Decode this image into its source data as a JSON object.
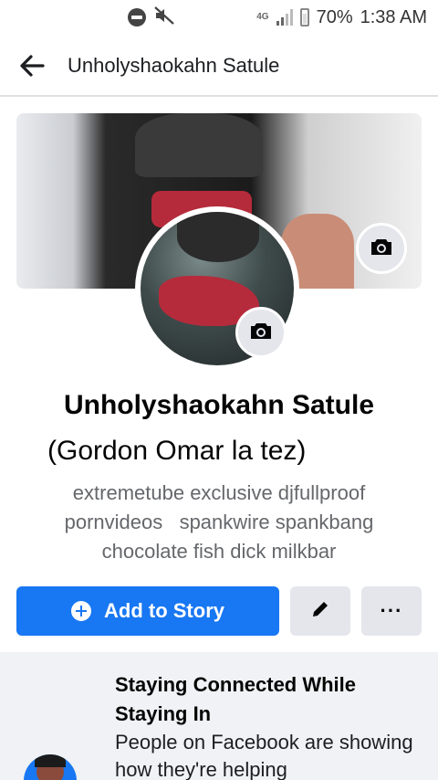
{
  "status_bar": {
    "network": "4G",
    "battery": "70%",
    "time": "1:38 AM"
  },
  "header": {
    "title": "Unholyshaokahn Satule"
  },
  "profile": {
    "name": "Unholyshaokahn Satule",
    "alternate_name": "(Gordon Omar la tez)",
    "bio_lines": [
      "extremetube exclusive djfullproof",
      "pornvideos   spankwire spankbang",
      "chocolate fish dick milkbar"
    ]
  },
  "actions": {
    "add_story": "Add to Story",
    "more": "···"
  },
  "info_card": {
    "title": "Staying Connected While Staying In",
    "text": "People on Facebook are showing how they're helping"
  },
  "colors": {
    "accent": "#1877f2",
    "button_grey": "#e4e6eb",
    "card_bg": "#f0f2f5"
  },
  "icons": [
    "do-not-disturb-icon",
    "mute-icon",
    "signal-icon",
    "battery-icon",
    "back-arrow-icon",
    "camera-icon",
    "plus-circle-icon",
    "pencil-icon",
    "more-icon"
  ]
}
